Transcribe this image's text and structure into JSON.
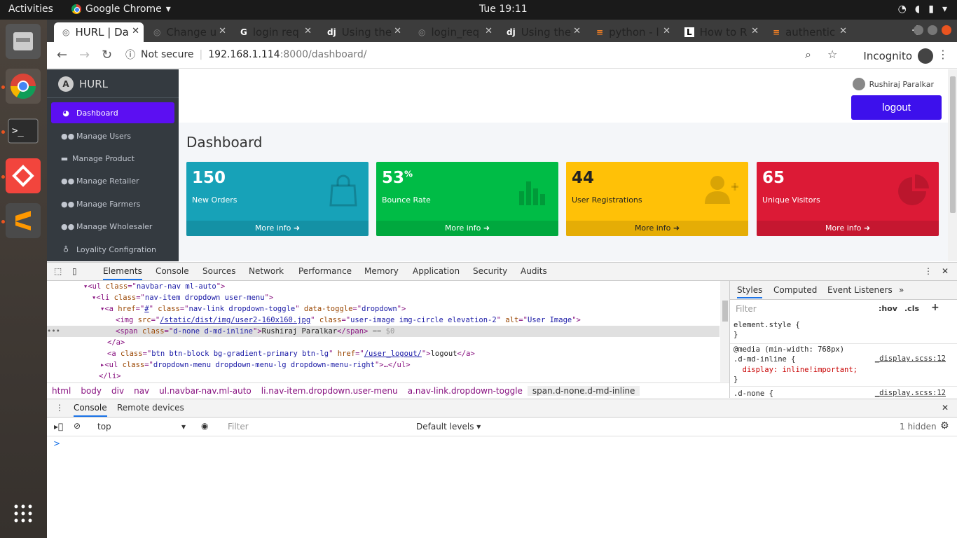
{
  "os": {
    "activities": "Activities",
    "app_name": "Google Chrome",
    "clock": "Tue 19:11"
  },
  "browser": {
    "tabs": [
      {
        "title": "HURL | Da",
        "active": true
      },
      {
        "title": "Change u",
        "active": false
      },
      {
        "title": "login req",
        "active": false
      },
      {
        "title": "Using the",
        "active": false
      },
      {
        "title": "login_req",
        "active": false
      },
      {
        "title": "Using the",
        "active": false
      },
      {
        "title": "python - l",
        "active": false
      },
      {
        "title": "How to R",
        "active": false
      },
      {
        "title": "authentic",
        "active": false
      }
    ],
    "security_label": "Not secure",
    "url_host": "192.168.1.114",
    "url_path": ":8000/dashboard/",
    "incognito_label": "Incognito"
  },
  "sidebar": {
    "brand": "HURL",
    "items": [
      {
        "label": "Dashboard",
        "icon": "dashboard-icon"
      },
      {
        "label": "Manage Users",
        "icon": "users-icon"
      },
      {
        "label": "Manage Product",
        "icon": "inbox-icon"
      },
      {
        "label": "Manage Retailer",
        "icon": "users-icon"
      },
      {
        "label": "Manage Farmers",
        "icon": "users-icon"
      },
      {
        "label": "Manage Wholesaler",
        "icon": "users-icon"
      },
      {
        "label": "Loyality Configration",
        "icon": "award-icon"
      }
    ]
  },
  "header": {
    "user_name": "Rushiraj Paralkar",
    "logout_label": "logout"
  },
  "page": {
    "title": "Dashboard",
    "boxes": [
      {
        "value": "150",
        "suffix": "",
        "label": "New Orders",
        "more": "More info",
        "color": "#17a2b8"
      },
      {
        "value": "53",
        "suffix": "%",
        "label": "Bounce Rate",
        "more": "More info",
        "color": "#00bc46"
      },
      {
        "value": "44",
        "suffix": "",
        "label": "User Registrations",
        "more": "More info",
        "color": "#ffc107"
      },
      {
        "value": "65",
        "suffix": "",
        "label": "Unique Visitors",
        "more": "More info",
        "color": "#dc1a36"
      }
    ]
  },
  "devtools": {
    "tabs": [
      "Elements",
      "Console",
      "Sources",
      "Network",
      "Performance",
      "Memory",
      "Application",
      "Security",
      "Audits"
    ],
    "breadcrumbs": [
      "html",
      "body",
      "div",
      "nav",
      "ul.navbar-nav.ml-auto",
      "li.nav-item.dropdown.user-menu",
      "a.nav-link.dropdown-toggle",
      "span.d-none.d-md-inline"
    ],
    "styles_tabs": [
      "Styles",
      "Computed",
      "Event Listeners"
    ],
    "filter_placeholder": "Filter",
    "hov": ":hov",
    "cls": ".cls",
    "rule1": "element.style {\n}",
    "rule2": "@media (min-width: 768px)\n.d-md-inline {",
    "rule2_decl": "  display: inline!important;",
    "rule2_end": "}",
    "rule3": ".d-none {",
    "src": "_display.scss:12",
    "console_tabs": [
      "Console",
      "Remote devices"
    ],
    "context": "top",
    "levels": "Default levels",
    "hidden": "1 hidden",
    "prompt": ">",
    "dom": {
      "l1a": "<ul ",
      "l1b": "class",
      "l1c": "=\"",
      "l1d": "navbar-nav ml-auto",
      "l1e": "\">",
      "l2d": "nav-item dropdown user-menu",
      "l3h": "#",
      "l3d": "nav-link dropdown-toggle",
      "l3t": "dropdown",
      "l4s": "/static/dist/img/user2-160x160.jpg",
      "l4c": "user-image img-circle elevation-2",
      "l4alt": "User Image",
      "l5c": "d-none d-md-inline",
      "l5t": "Rushiraj Paralkar",
      "l5e": "== $0",
      "l6": "</a>",
      "l7c": "btn btn-block bg-gradient-primary btn-lg",
      "l7h": "/user_logout/",
      "l7t": "logout",
      "l8c": "dropdown-menu dropdown-menu-lg dropdown-menu-right",
      "l9": "</li>"
    }
  }
}
